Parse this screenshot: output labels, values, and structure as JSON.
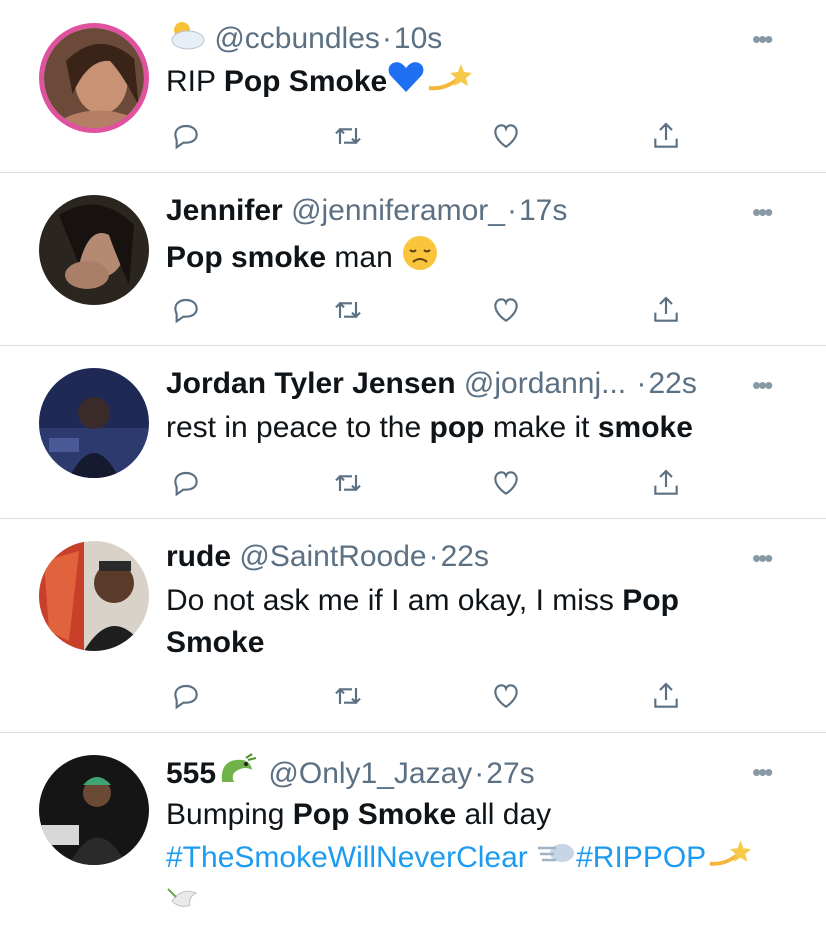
{
  "tweets": [
    {
      "name": "",
      "handle": "@ccbundles",
      "time": "10s",
      "text_parts": [
        "RIP ",
        "Pop Smoke",
        ""
      ],
      "emoji_prefix": "cloud-sun-emoji",
      "emoji_suffix": [
        "blue-heart-emoji",
        "dizzy-emoji"
      ],
      "avatar": "avatar-ccbundles"
    },
    {
      "name": "Jennifer",
      "handle": "@jenniferamor_",
      "time": "17s",
      "text_parts": [
        "Pop smoke",
        " man "
      ],
      "emoji_suffix": [
        "disappointed-face-emoji"
      ],
      "avatar": "avatar-jennifer"
    },
    {
      "name": "Jordan Tyler Jensen",
      "handle": "@jordannj...",
      "time": "22s",
      "text_parts": [
        "rest in peace to the ",
        "pop",
        " make it ",
        "smoke"
      ],
      "avatar": "avatar-jordan"
    },
    {
      "name": "rude",
      "handle": "@SaintRoode",
      "time": "22s",
      "text_parts": [
        "Do not ask me if I am okay, I miss ",
        "Pop Smoke"
      ],
      "avatar": "avatar-rude"
    },
    {
      "name": "555",
      "handle": "@Only1_Jazay",
      "time": "27s",
      "text_parts": [
        "Bumping ",
        "Pop Smoke",
        " all day"
      ],
      "hashtags": [
        "#TheSmokeWillNeverClear",
        "#RIPPOP"
      ],
      "emoji_after_name": "dragon-emoji",
      "avatar": "avatar-555"
    }
  ],
  "more_label": "•••",
  "icons": {
    "reply": "reply-icon",
    "retweet": "retweet-icon",
    "like": "like-icon",
    "share": "share-icon"
  },
  "colors": {
    "text": "#0f1419",
    "secondary": "#5b7083",
    "icon": "#5b7083",
    "hashtag": "#1d9bf0",
    "divider": "#dcdcdc",
    "avatar_ring": "#e0519f"
  }
}
